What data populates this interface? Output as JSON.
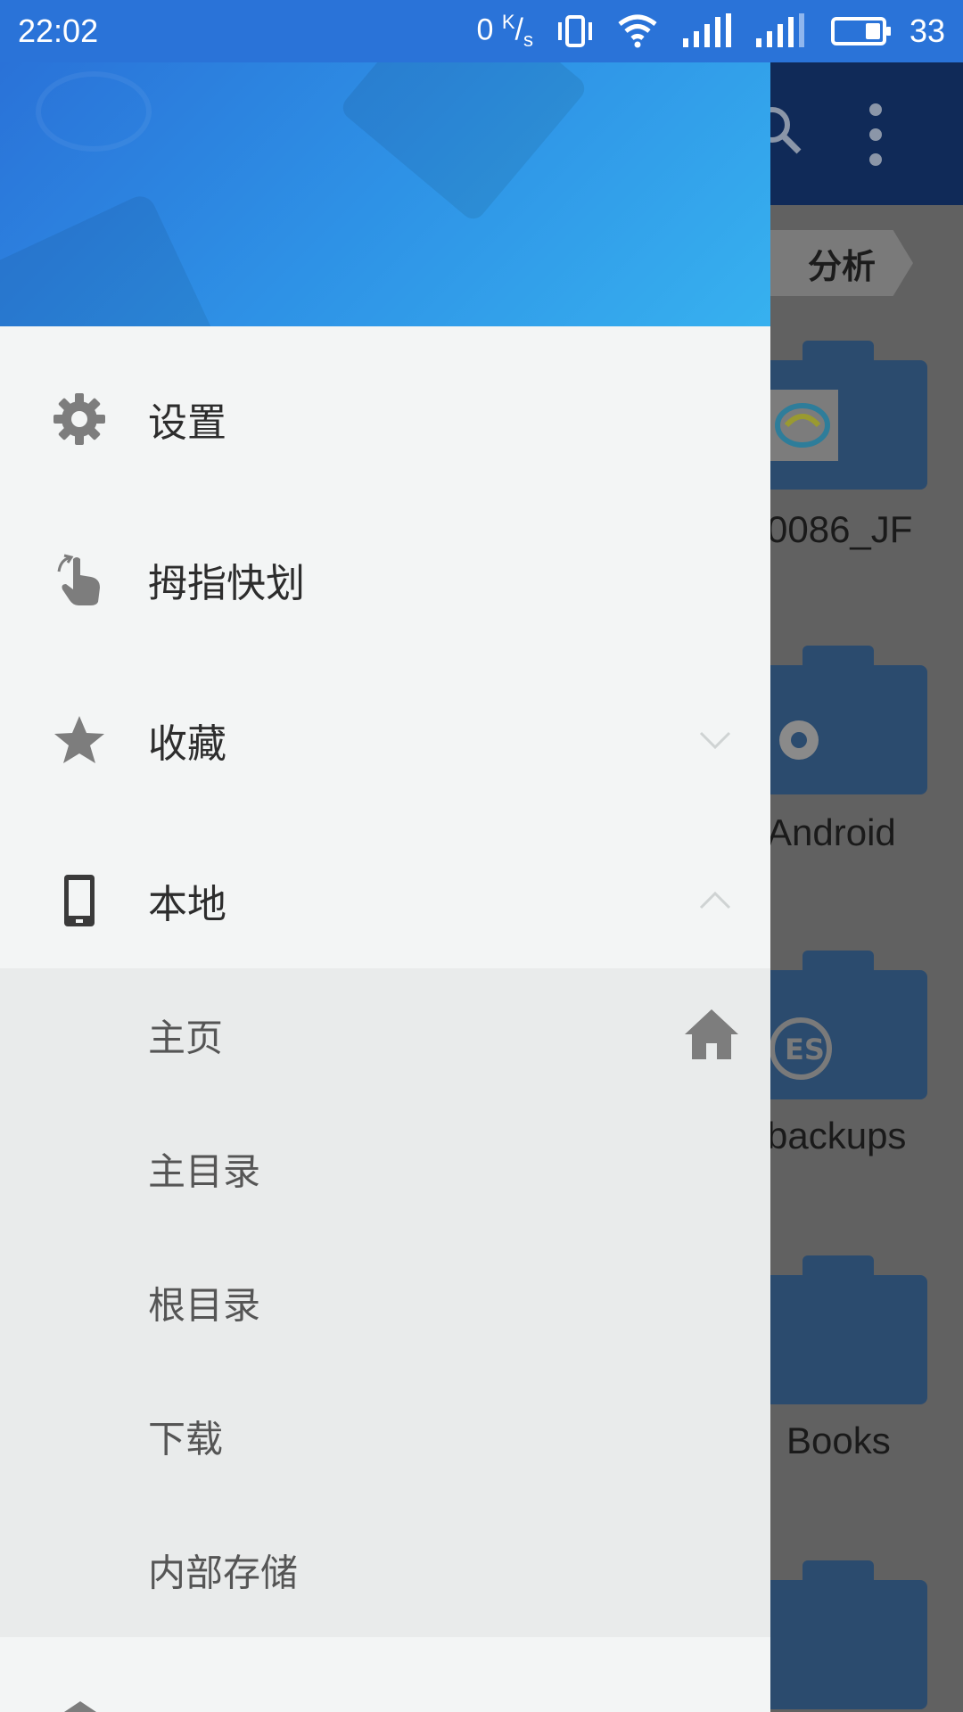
{
  "status_bar": {
    "time": "22:02",
    "speed_value": "0",
    "speed_unit_top": "K",
    "speed_unit_bottom": "s",
    "battery": "33"
  },
  "background": {
    "breadcrumb": "分析",
    "folders": [
      {
        "name": "0086_JF"
      },
      {
        "name": "Android"
      },
      {
        "name": "backups"
      },
      {
        "name": "Books"
      }
    ],
    "colors": {
      "toolbar": "#102a58",
      "folder": "#2b4b6e",
      "overlay": "#616161"
    }
  },
  "drawer": {
    "menu": [
      {
        "label": "设置",
        "icon": "gear-icon"
      },
      {
        "label": "拇指快划",
        "icon": "swipe-hand-icon"
      },
      {
        "label": "收藏",
        "icon": "star-icon",
        "expanded": false
      },
      {
        "label": "本地",
        "icon": "phone-icon",
        "expanded": true
      }
    ],
    "local_items": [
      {
        "label": "主页",
        "icon": "home-icon"
      },
      {
        "label": "主目录"
      },
      {
        "label": "根目录"
      },
      {
        "label": "下载"
      },
      {
        "label": "内部存储"
      }
    ],
    "colors": {
      "header_start": "#2a72d8",
      "header_end": "#37b1ef",
      "background": "#f3f5f5",
      "submenu": "#e9ebeb"
    }
  }
}
